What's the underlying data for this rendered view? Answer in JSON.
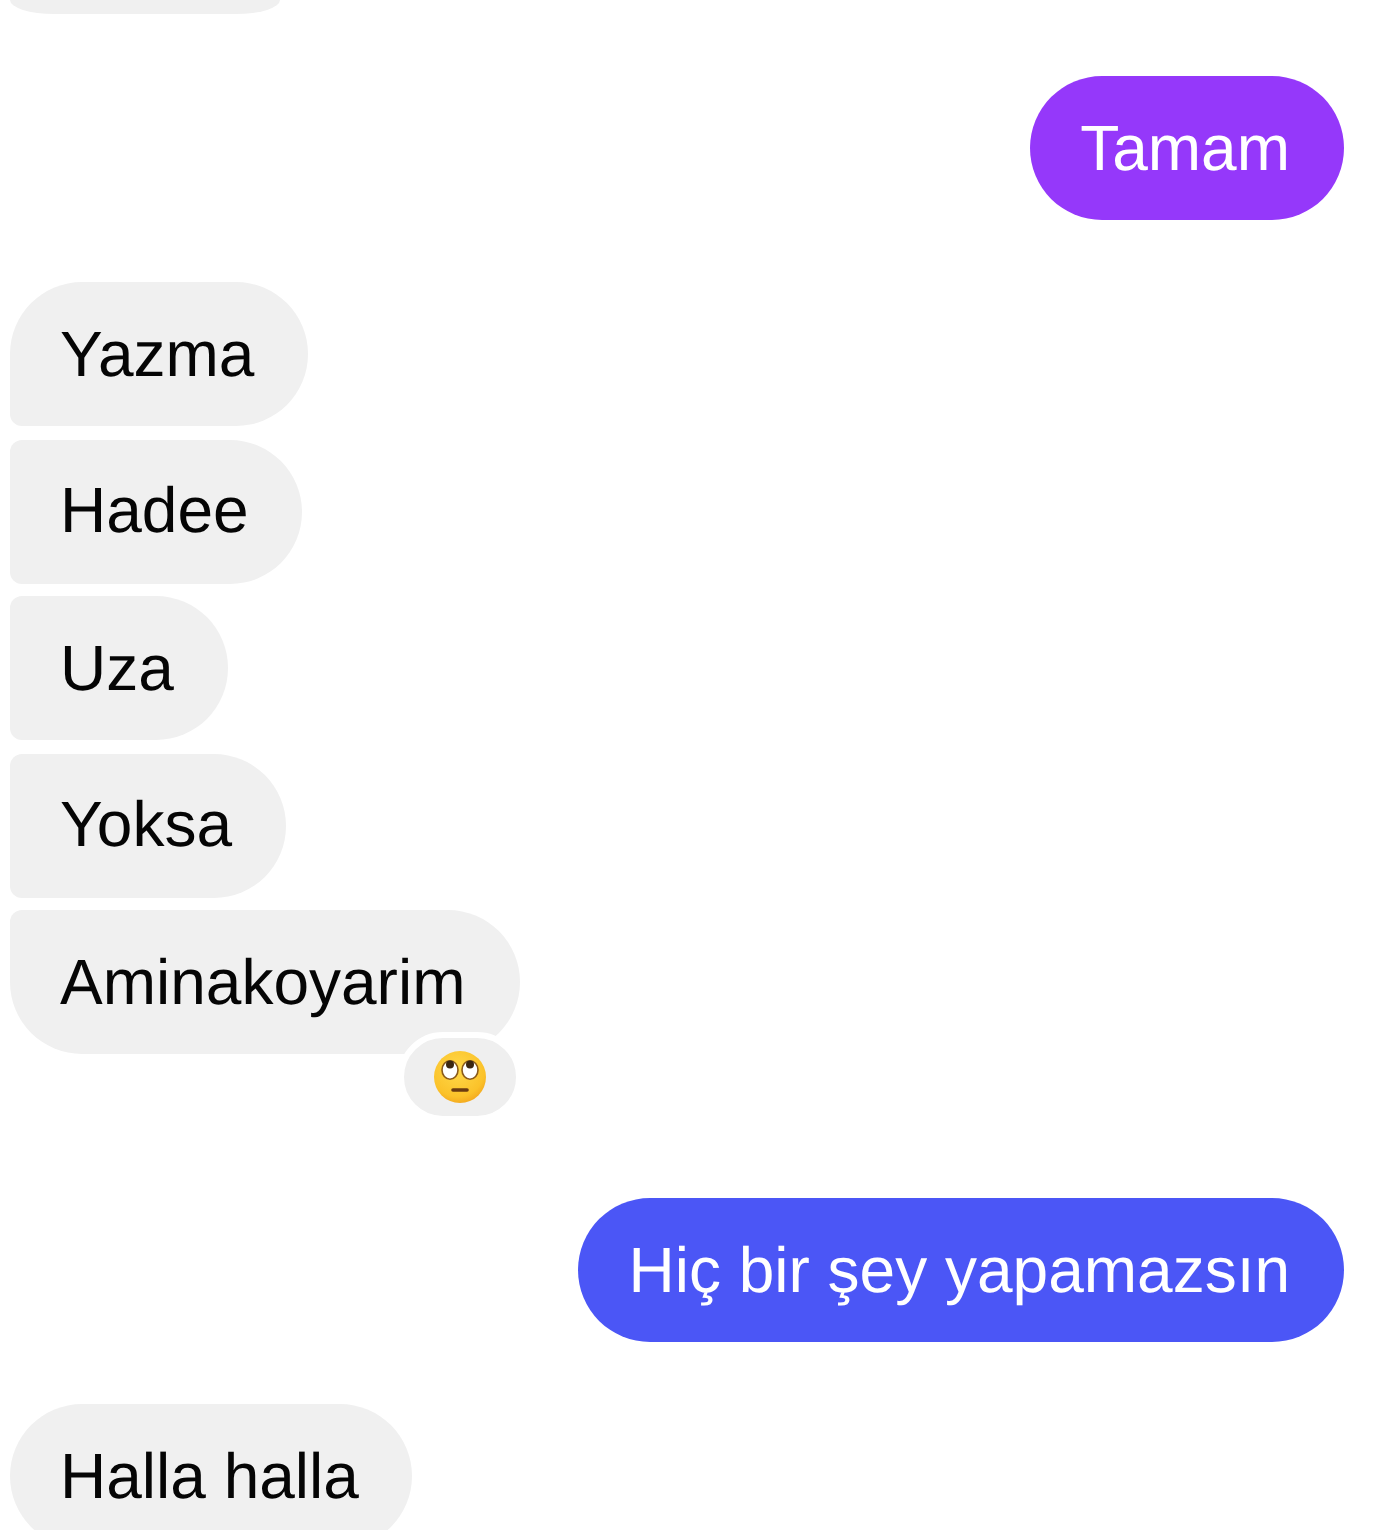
{
  "messages": [
    {
      "kind": "received",
      "reacted": false
    },
    {
      "kind": "sent",
      "text": "Tamam",
      "color": "#9538fa",
      "reacted": false
    },
    {
      "kind": "received",
      "text": "Yazma",
      "reacted": false
    },
    {
      "kind": "received",
      "text": "Hadee",
      "reacted": false
    },
    {
      "kind": "received",
      "text": "Uza",
      "reacted": false
    },
    {
      "kind": "received",
      "text": "Yoksa",
      "reacted": false
    },
    {
      "kind": "received",
      "text": "Aminakoyarim",
      "reacted": true
    },
    {
      "kind": "sent",
      "text": "Hiç bir şey yapamazsın",
      "color": "#4b56f6",
      "reacted": false
    },
    {
      "kind": "received",
      "text": "Halla halla",
      "reacted": false
    }
  ]
}
